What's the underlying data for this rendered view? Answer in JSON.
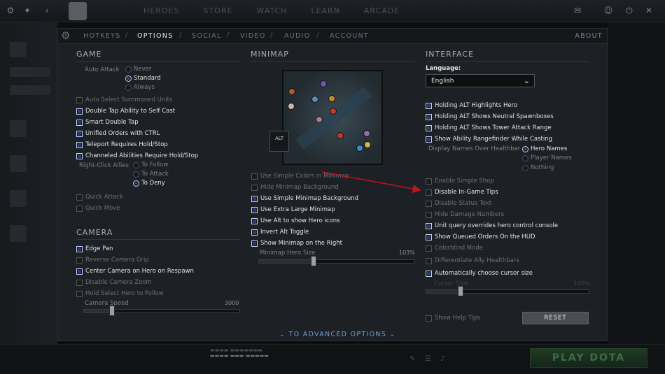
{
  "topnav": [
    "HEROES",
    "STORE",
    "WATCH",
    "LEARN",
    "ARCADE"
  ],
  "tabs": [
    {
      "label": "HOTKEYS",
      "active": false
    },
    {
      "label": "OPTIONS",
      "active": true
    },
    {
      "label": "SOCIAL",
      "active": false
    },
    {
      "label": "VIDEO",
      "active": false
    },
    {
      "label": "AUDIO",
      "active": false
    },
    {
      "label": "ACCOUNT",
      "active": false
    }
  ],
  "about": "ABOUT",
  "game": {
    "title": "GAME",
    "auto_attack_label": "Auto Attack",
    "auto_attack_options": [
      "Never",
      "Standard",
      "Always"
    ],
    "auto_attack_selected": "Standard",
    "auto_select_summoned": "Auto Select Summoned Units",
    "double_tap_self": "Double Tap Ability to Self Cast",
    "smart_double_tap": "Smart Double Tap",
    "unified_orders": "Unified Orders with CTRL",
    "teleport_hold": "Teleport Requires Hold/Stop",
    "channeled_hold": "Channeled Abilities Require Hold/Stop",
    "right_click_label": "Right-Click Allies",
    "right_click_options": [
      "To Follow",
      "To Attack",
      "To Deny"
    ],
    "right_click_selected": "To Deny",
    "quick_attack": "Quick Attack",
    "quick_move": "Quick Move"
  },
  "camera": {
    "title": "CAMERA",
    "edge_pan": "Edge Pan",
    "reverse_grip": "Reverse Camera Grip",
    "center_respawn": "Center Camera on Hero on Respawn",
    "disable_zoom": "Disable Camera Zoom",
    "hold_select": "Hold Select Hero to Follow",
    "speed_label": "Camera Speed",
    "speed_value": "3000",
    "speed_level": 0.18
  },
  "minimap": {
    "title": "MINIMAP",
    "alt_label": "ALT",
    "simple_colors": "Use Simple Colors in Minimap",
    "hide_bg": "Hide Minimap Background",
    "simple_bg": "Use Simple Minimap Background",
    "extra_large": "Use Extra Large Minimap",
    "alt_hero_icons": "Use Alt to show Hero icons",
    "invert_alt": "Invert Alt Toggle",
    "show_right": "Show Minimap on the Right",
    "hero_size_label": "Minimap Hero Size",
    "hero_size_value": "103%",
    "hero_size_level": 0.35
  },
  "interface": {
    "title": "INTERFACE",
    "language_label": "Language:",
    "language_value": "English",
    "alt_highlights": "Holding ALT Highlights Hero",
    "alt_neutral": "Holding ALT Shows Neutral Spawnboxes",
    "alt_tower": "Holding ALT Shows Tower Attack Range",
    "rangefinder": "Show Ability Rangefinder While Casting",
    "display_names_label": "Display Names Over Healthbar",
    "display_names_options": [
      "Hero Names",
      "Player Names",
      "Nothing"
    ],
    "display_names_selected": "Hero Names",
    "simple_shop": "Enable Simple Shop",
    "disable_tips": "Disable In-Game Tips",
    "disable_status": "Disable Status Text",
    "hide_damage": "Hide Damage Numbers",
    "unit_query": "Unit query overrides hero control console",
    "queued_orders": "Show Queued Orders On the HUD",
    "colorblind": "Colorblind Mode",
    "ally_healthbars": "Differentiate Ally Healthbars",
    "auto_cursor": "Automatically choose cursor size",
    "cursor_size_label": "Cursor Size",
    "cursor_size_value": "100%",
    "cursor_size_level": 0.21,
    "help_tips": "Show Help Tips",
    "reset": "RESET"
  },
  "advanced_options": "TO ADVANCED OPTIONS",
  "play_button": "PLAY DOTA",
  "colors": {
    "accent": "#6f9fd4",
    "checked": "#2a3a7a",
    "annotation_arrow": "#c0161a"
  }
}
